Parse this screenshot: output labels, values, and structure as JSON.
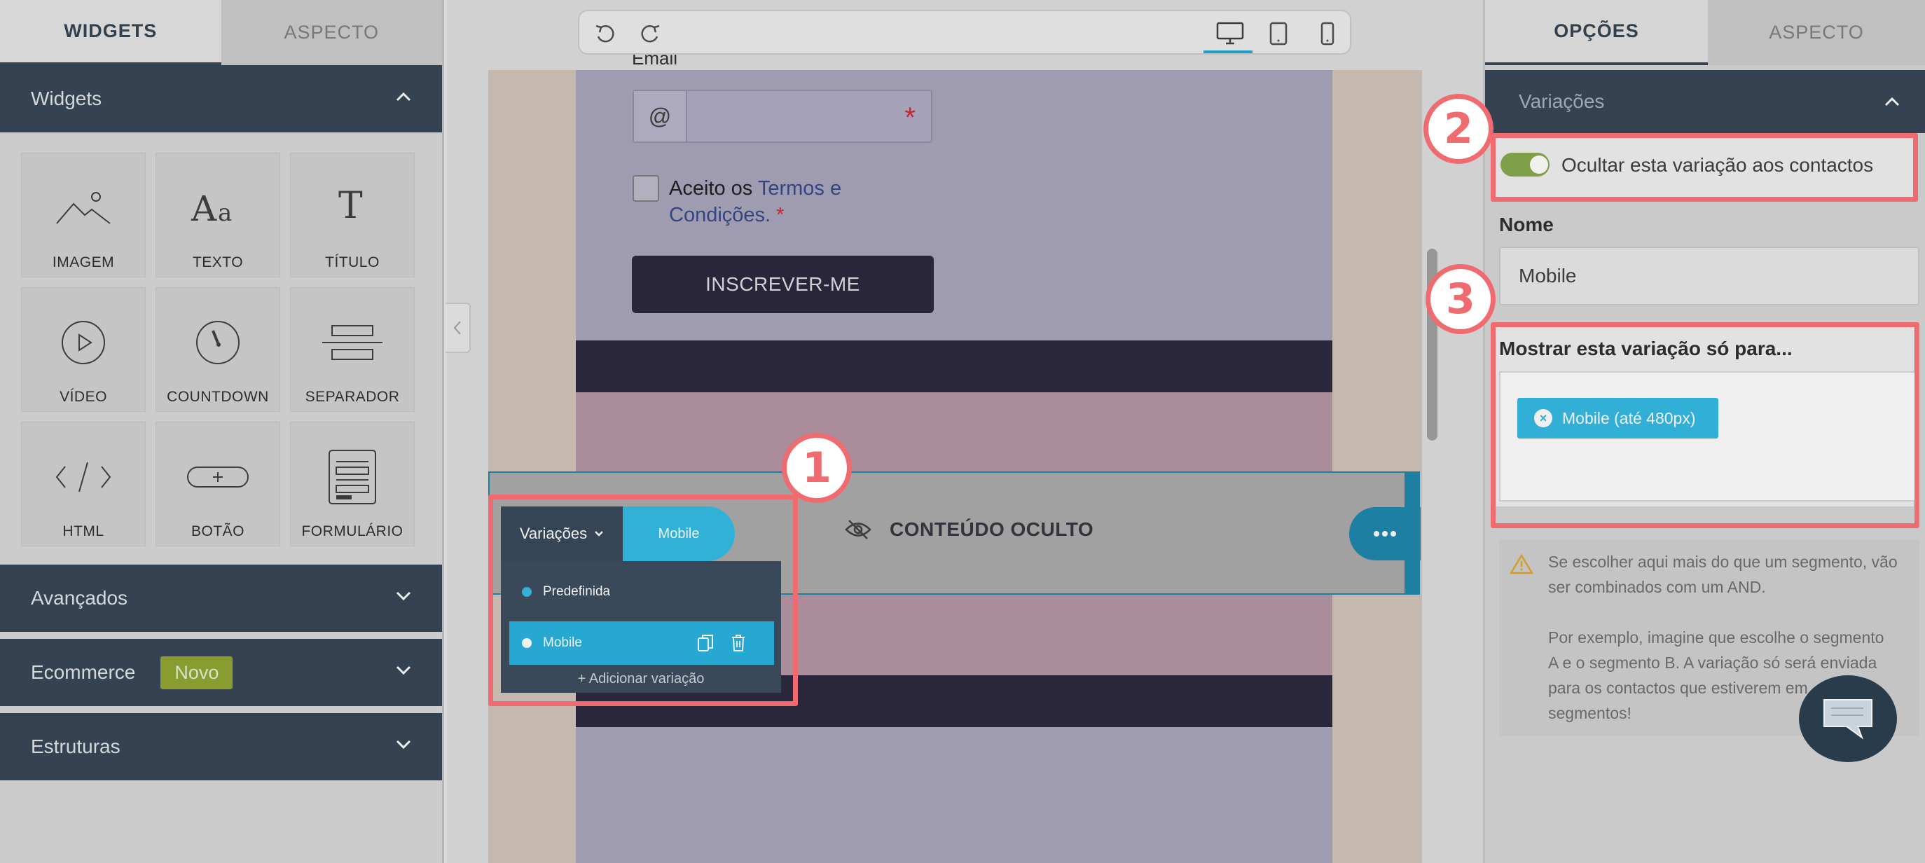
{
  "left_panel": {
    "tabs": [
      {
        "label": "WIDGETS",
        "active": true
      },
      {
        "label": "ASPECTO",
        "active": false
      }
    ],
    "widgets_section": {
      "title": "Widgets"
    },
    "widgets": [
      {
        "label": "IMAGEM",
        "icon": "image-icon"
      },
      {
        "label": "TEXTO",
        "icon": "text-icon"
      },
      {
        "label": "TÍTULO",
        "icon": "title-icon"
      },
      {
        "label": "VÍDEO",
        "icon": "video-icon"
      },
      {
        "label": "COUNTDOWN",
        "icon": "countdown-icon"
      },
      {
        "label": "SEPARADOR",
        "icon": "separator-icon"
      },
      {
        "label": "HTML",
        "icon": "code-icon"
      },
      {
        "label": "BOTÃO",
        "icon": "button-icon"
      },
      {
        "label": "FORMULÁRIO",
        "icon": "form-icon"
      }
    ],
    "sections": [
      {
        "title": "Avançados"
      },
      {
        "title": "Ecommerce",
        "badge": "Novo"
      },
      {
        "title": "Estruturas"
      }
    ]
  },
  "toolbar": {
    "undo_icon": "undo-icon",
    "redo_icon": "redo-icon",
    "devices": [
      "desktop",
      "tablet",
      "mobile"
    ],
    "active_device": "desktop"
  },
  "canvas": {
    "email_label": "Email",
    "email_prefix": "@",
    "required_mark": "*",
    "terms_prefix": "Aceito os",
    "terms_link": "Termos e Condições.",
    "submit_label": "INSCREVER-ME",
    "hidden_content_label": "CONTEÚDO OCULTO",
    "variations": {
      "dropdown_label": "Variações",
      "current": "Mobile",
      "items": [
        {
          "label": "Predefinida",
          "selected": false
        },
        {
          "label": "Mobile",
          "selected": true
        }
      ],
      "add_label": "+ Adicionar variação"
    }
  },
  "right_panel": {
    "tabs": [
      {
        "label": "OPÇÕES",
        "active": true
      },
      {
        "label": "ASPECTO",
        "active": false
      }
    ],
    "section_title": "Variações",
    "toggle_label": "Ocultar esta variação aos contactos",
    "toggle_on": true,
    "name_label": "Nome",
    "name_value": "Mobile",
    "show_label": "Mostrar esta variação só para...",
    "chips": [
      "Mobile (até 480px)"
    ],
    "warning_lines": [
      "Se escolher aqui mais do que um segmento, vão",
      "ser combinados com um AND.",
      "",
      "Por exemplo, imagine que escolhe o segmento",
      "A e o segmento B. A variação só será enviada",
      "para os contactos que estiverem em",
      "segmentos!"
    ]
  },
  "annotations": {
    "step_1": "1",
    "step_2": "2",
    "step_3": "3"
  },
  "colors": {
    "dark_navy": "#2a3a4b",
    "accent_blue": "#26b6e3",
    "toggle_green": "#7fa341",
    "highlight_red": "#ef6b70",
    "badge_green": "#8aa024"
  }
}
